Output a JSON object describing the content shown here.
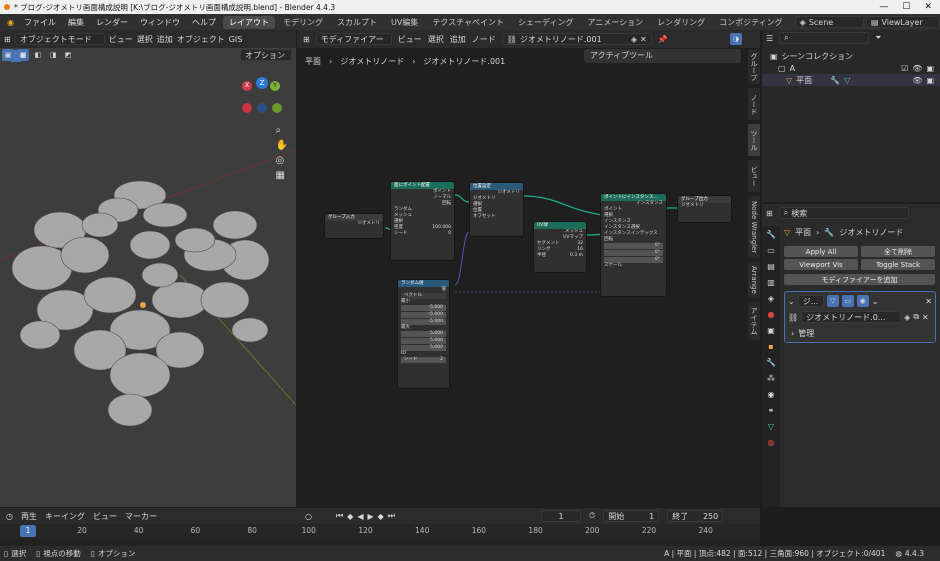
{
  "window": {
    "title": "* ブログ-ジオメトリ画面構成説明 [K:\\ブログ-ジオメトリ画面構成説明.blend] - Blender 4.4.3"
  },
  "menubar": {
    "menus": [
      "ファイル",
      "編集",
      "レンダー",
      "ウィンドウ",
      "ヘルプ"
    ],
    "workspaces": [
      "レイアウト",
      "モデリング",
      "スカルプト",
      "UV編集",
      "テクスチャペイント",
      "シェーディング",
      "アニメーション",
      "レンダリング",
      "コンポジティング"
    ],
    "active_workspace": "レイアウト",
    "scene": "Scene",
    "view_layer": "ViewLayer"
  },
  "viewport": {
    "mode": "オブジェクトモード",
    "menus": [
      "ビュー",
      "選択",
      "追加",
      "オブジェクト",
      "GIS"
    ],
    "options": "オプション",
    "gizmo": {
      "z": "Z",
      "y": "Y",
      "x": "X"
    }
  },
  "node_editor": {
    "editor_type": "モディファイアー",
    "menus": [
      "ビュー",
      "選択",
      "追加",
      "ノード"
    ],
    "tree_name": "ジオメトリノード.001",
    "breadcrumb": [
      "平面",
      "ジオメトリノード",
      "ジオメトリノード.001"
    ],
    "active_tool_panel": "アクティブツール",
    "side_tabs": [
      "グループ",
      "ノード",
      "ツール",
      "ビュー",
      "Node Wrangler",
      "Arrange",
      "アイテム"
    ],
    "nodes": {
      "group_input": {
        "title": "グループ入力",
        "sockets": [
          "ジオメトリ"
        ]
      },
      "distribute": {
        "title": "面にポイント配置",
        "sockets": [
          "ポイント",
          "ノーマル",
          "回転",
          "ランダム",
          "メッシュ",
          "選択",
          "密度",
          "シード"
        ],
        "density": "100.000",
        "seed": "0"
      },
      "set_position": {
        "title": "位置設定",
        "sockets": [
          "ジオメトリ",
          "ジオメトリ",
          "選択",
          "位置",
          "オフセット"
        ]
      },
      "uv_sphere": {
        "title": "UV球",
        "sockets": [
          "メッシュ",
          "UVマップ",
          "セグメント",
          "リング",
          "半径"
        ],
        "segments": "32",
        "rings": "16",
        "radius": "0.3 m"
      },
      "instance": {
        "title": "ポイントにインスタンス...",
        "sockets": [
          "インスタンス",
          "ポイント",
          "選択",
          "インスタンス",
          "インスタンス選択",
          "インスタンスインデックス",
          "回転",
          "スケール"
        ],
        "rot": [
          "0°",
          "0°",
          "0°"
        ]
      },
      "group_output": {
        "title": "グループ出力",
        "sockets": [
          "ジオメトリ"
        ]
      },
      "random": {
        "title": "ランダム値",
        "sockets": [
          "値",
          "ベクトル",
          "最小",
          "最大",
          "ID",
          "シード"
        ],
        "min": [
          "-5.000",
          "-5.000",
          "-5.000"
        ],
        "max": [
          "5.000",
          "5.000",
          "5.000"
        ],
        "seed": "2"
      }
    }
  },
  "outliner": {
    "search_placeholder": "",
    "collection": "シーンコレクション",
    "items": [
      {
        "name": "A"
      },
      {
        "name": "平面"
      }
    ]
  },
  "properties": {
    "search_placeholder": "検索",
    "breadcrumb": [
      "平面",
      "ジオメトリノード"
    ],
    "buttons": {
      "apply_all": "Apply All",
      "delete_all": "全て削除",
      "viewport_vis": "Viewport Vis",
      "toggle_stack": "Toggle Stack",
      "add_modifier": "モディファイアーを追加"
    },
    "modifier": {
      "name": "ジ...",
      "tree": "ジオメトリノード.0...",
      "manage": "管理"
    }
  },
  "timeline": {
    "menus": [
      "再生",
      "キーイング",
      "ビュー",
      "マーカー"
    ],
    "current_frame": "1",
    "start_label": "開始",
    "start": "1",
    "end_label": "終了",
    "end": "250",
    "ticks": [
      "1",
      "20",
      "40",
      "60",
      "80",
      "100",
      "120",
      "140",
      "160",
      "180",
      "200",
      "220",
      "240"
    ]
  },
  "statusbar": {
    "items": [
      "選択",
      "視点の移動",
      "オプション"
    ],
    "stats": "A | 平面 | 頂点:482 | 面:512 | 三角面:960 | オブジェクト:0/401",
    "version": "4.4.3"
  },
  "colors": {
    "accent": "#4772b3",
    "active_ws": "#4a4a4a",
    "node_green": "#1c6d5a",
    "node_blue": "#2a5a7a",
    "link": "#1bb097"
  }
}
